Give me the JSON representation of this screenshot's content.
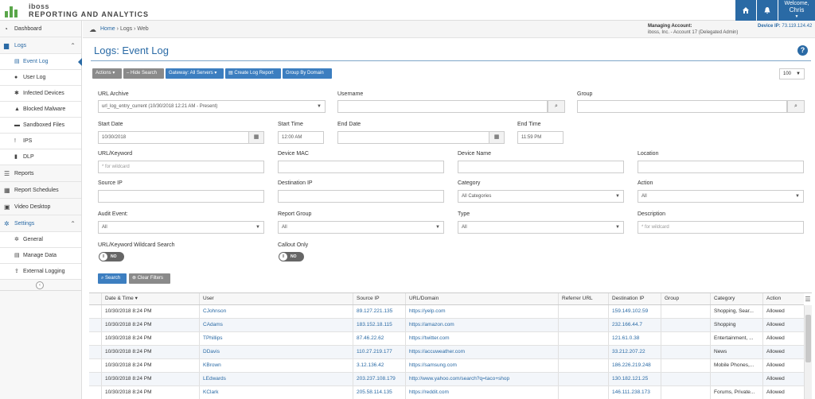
{
  "brand": {
    "name": "iboss",
    "subtitle": "REPORTING AND ANALYTICS"
  },
  "topbar": {
    "welcome_line": "Welcome,",
    "welcome_name": "Chris"
  },
  "sidebar": {
    "items": [
      {
        "label": "Dashboard",
        "icon": "dashboard-icon"
      },
      {
        "label": "Logs",
        "icon": "folder-icon"
      },
      {
        "label": "Event Log",
        "icon": "file-icon"
      },
      {
        "label": "User Log",
        "icon": "user-icon"
      },
      {
        "label": "Infected Devices",
        "icon": "bug-icon"
      },
      {
        "label": "Blocked Malware",
        "icon": "shield-icon"
      },
      {
        "label": "Sandboxed Files",
        "icon": "archive-icon"
      },
      {
        "label": "IPS",
        "icon": "exclamation-icon"
      },
      {
        "label": "DLP",
        "icon": "lock-icon"
      },
      {
        "label": "Reports",
        "icon": "list-icon"
      },
      {
        "label": "Report Schedules",
        "icon": "calendar-icon"
      },
      {
        "label": "Video Desktop",
        "icon": "video-icon"
      },
      {
        "label": "Settings",
        "icon": "gear-icon"
      },
      {
        "label": "General",
        "icon": "gear-icon"
      },
      {
        "label": "Manage Data",
        "icon": "file-icon"
      },
      {
        "label": "External Logging",
        "icon": "export-icon"
      }
    ]
  },
  "breadcrumb": {
    "home": "Home",
    "sep": "›",
    "logs": "Logs",
    "web": "Web"
  },
  "account": {
    "managing_label": "Managing Account:",
    "managing_value": "iboss, Inc. - Account 17 (Delegated Admin)",
    "device_ip_label": "Device IP:",
    "device_ip_value": "73.119.124.42"
  },
  "page": {
    "title": "Logs: Event Log",
    "help": "?"
  },
  "toolbar": {
    "actions": "Actions ▾",
    "hide_search": "– Hide Search",
    "gateway": "Gateway: All Servers ▾",
    "create_report": "Create Log Report",
    "group_by_domain": "Group By Domain",
    "page_size": "100"
  },
  "form": {
    "url_archive_label": "URL Archive",
    "url_archive_value": "url_log_entry_current (10/30/2018 12:21 AM - Present)",
    "username_label": "Username",
    "group_label": "Group",
    "start_date_label": "Start Date",
    "start_date_value": "10/30/2018",
    "start_time_label": "Start Time",
    "start_time_value": "12:00 AM",
    "end_date_label": "End Date",
    "end_time_label": "End Time",
    "end_time_value": "11:59 PM",
    "url_keyword_label": "URL/Keyword",
    "url_keyword_placeholder": "* for wildcard",
    "device_mac_label": "Device MAC",
    "device_name_label": "Device Name",
    "location_label": "Location",
    "source_ip_label": "Source IP",
    "destination_ip_label": "Destination IP",
    "category_label": "Category",
    "category_value": "All Categories",
    "action_label": "Action",
    "action_value": "All",
    "audit_event_label": "Audit Event:",
    "audit_event_value": "All",
    "report_group_label": "Report Group",
    "report_group_value": "All",
    "type_label": "Type",
    "type_value": "All",
    "description_label": "Description",
    "description_placeholder": "* for wildcard",
    "wildcard_search_label": "URL/Keyword Wildcard Search",
    "wildcard_search_state": "NO",
    "callout_only_label": "Callout Only",
    "callout_only_state": "NO",
    "search_button": "Search",
    "clear_button": "Clear Filters"
  },
  "table": {
    "columns": [
      "Date & Time ▾",
      "User",
      "Source IP",
      "URL/Domain",
      "Referrer URL",
      "Destination IP",
      "Group",
      "Category",
      "Action"
    ],
    "rows": [
      [
        "10/30/2018 8:24 PM",
        "CJohnson",
        "89.127.221.135",
        "https://yelp.com",
        "",
        "159.149.102.59",
        "",
        "Shopping, Sear...",
        "Allowed"
      ],
      [
        "10/30/2018 8:24 PM",
        "CAdams",
        "183.152.18.115",
        "https://amazon.com",
        "",
        "232.166.44.7",
        "",
        "Shopping",
        "Allowed"
      ],
      [
        "10/30/2018 8:24 PM",
        "TPhillips",
        "87.46.22.62",
        "https://twitter.com",
        "",
        "121.61.0.38",
        "",
        "Entertainment, ...",
        "Allowed"
      ],
      [
        "10/30/2018 8:24 PM",
        "DDavis",
        "110.27.219.177",
        "https://accuweather.com",
        "",
        "33.212.207.22",
        "",
        "News",
        "Allowed"
      ],
      [
        "10/30/2018 8:24 PM",
        "KBrown",
        "3.12.136.42",
        "https://samsung.com",
        "",
        "186.226.219.248",
        "",
        "Mobile Phones,...",
        "Allowed"
      ],
      [
        "10/30/2018 8:24 PM",
        "LEdwards",
        "203.237.108.179",
        "http://www.yahoo.com/search?q=taco+shop",
        "",
        "130.182.121.25",
        "",
        "",
        "Allowed"
      ],
      [
        "10/30/2018 8:24 PM",
        "KClark",
        "205.58.114.135",
        "https://reddit.com",
        "",
        "146.111.238.173",
        "",
        "Forums, Private...",
        "Allowed"
      ]
    ]
  }
}
